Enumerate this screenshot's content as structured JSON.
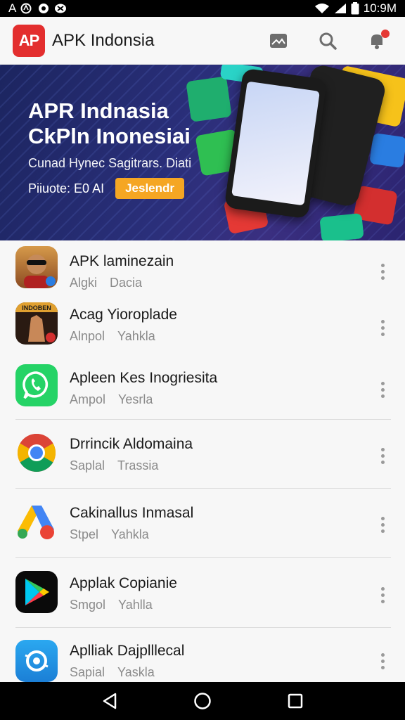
{
  "status_bar": {
    "left_icons": [
      "accessibility-icon",
      "media-icon",
      "tiktok-icon"
    ],
    "left_text": "A",
    "time": "10:9M",
    "right_icons": [
      "wifi-icon",
      "signal-icon",
      "battery-icon"
    ]
  },
  "app_bar": {
    "logo_text": "AP",
    "title": "APK Indonsia",
    "icons": [
      "gallery-icon",
      "search-icon",
      "notifications-icon"
    ]
  },
  "banner": {
    "title_line1": "APR Indnasia",
    "title_line2": "CkPln Inonesiai",
    "subtitle": "Cunad Hynec Sagitrars. Diati",
    "small_text": "Piiuote: E0 AI",
    "button_label": "Jeslendr"
  },
  "apps": [
    {
      "name": "APK laminezain",
      "meta1": "Algki",
      "meta2": "Dacia",
      "icon": "avatar-app-icon"
    },
    {
      "name": "Acag Yioroplade",
      "meta1": "Alnpol",
      "meta2": "Yahkla",
      "icon": "game-app-icon",
      "icon_text": "INDOBEN"
    },
    {
      "name": "Apleen Kes Inogriesita",
      "meta1": "Ampol",
      "meta2": "Yesrla",
      "icon": "whatsapp-icon"
    },
    {
      "name": "Drrincik Aldomaina",
      "meta1": "Saplal",
      "meta2": "Trassia",
      "icon": "chrome-icon"
    },
    {
      "name": "Cakinallus Inmasal",
      "meta1": "Stpel",
      "meta2": "Yahkla",
      "icon": "google-ads-icon"
    },
    {
      "name": "Applak Copianie",
      "meta1": "Smgol",
      "meta2": "Yahlla",
      "icon": "play-store-icon"
    },
    {
      "name": "Aplliak Dajplllecal",
      "meta1": "Sapial",
      "meta2": "Yaskla",
      "icon": "camera-app-icon"
    }
  ],
  "nav_bar": {
    "buttons": [
      "back-icon",
      "home-icon",
      "recents-icon"
    ]
  },
  "colors": {
    "accent_red": "#e32e2e",
    "banner_button": "#f5a623",
    "whatsapp": "#25d366"
  }
}
